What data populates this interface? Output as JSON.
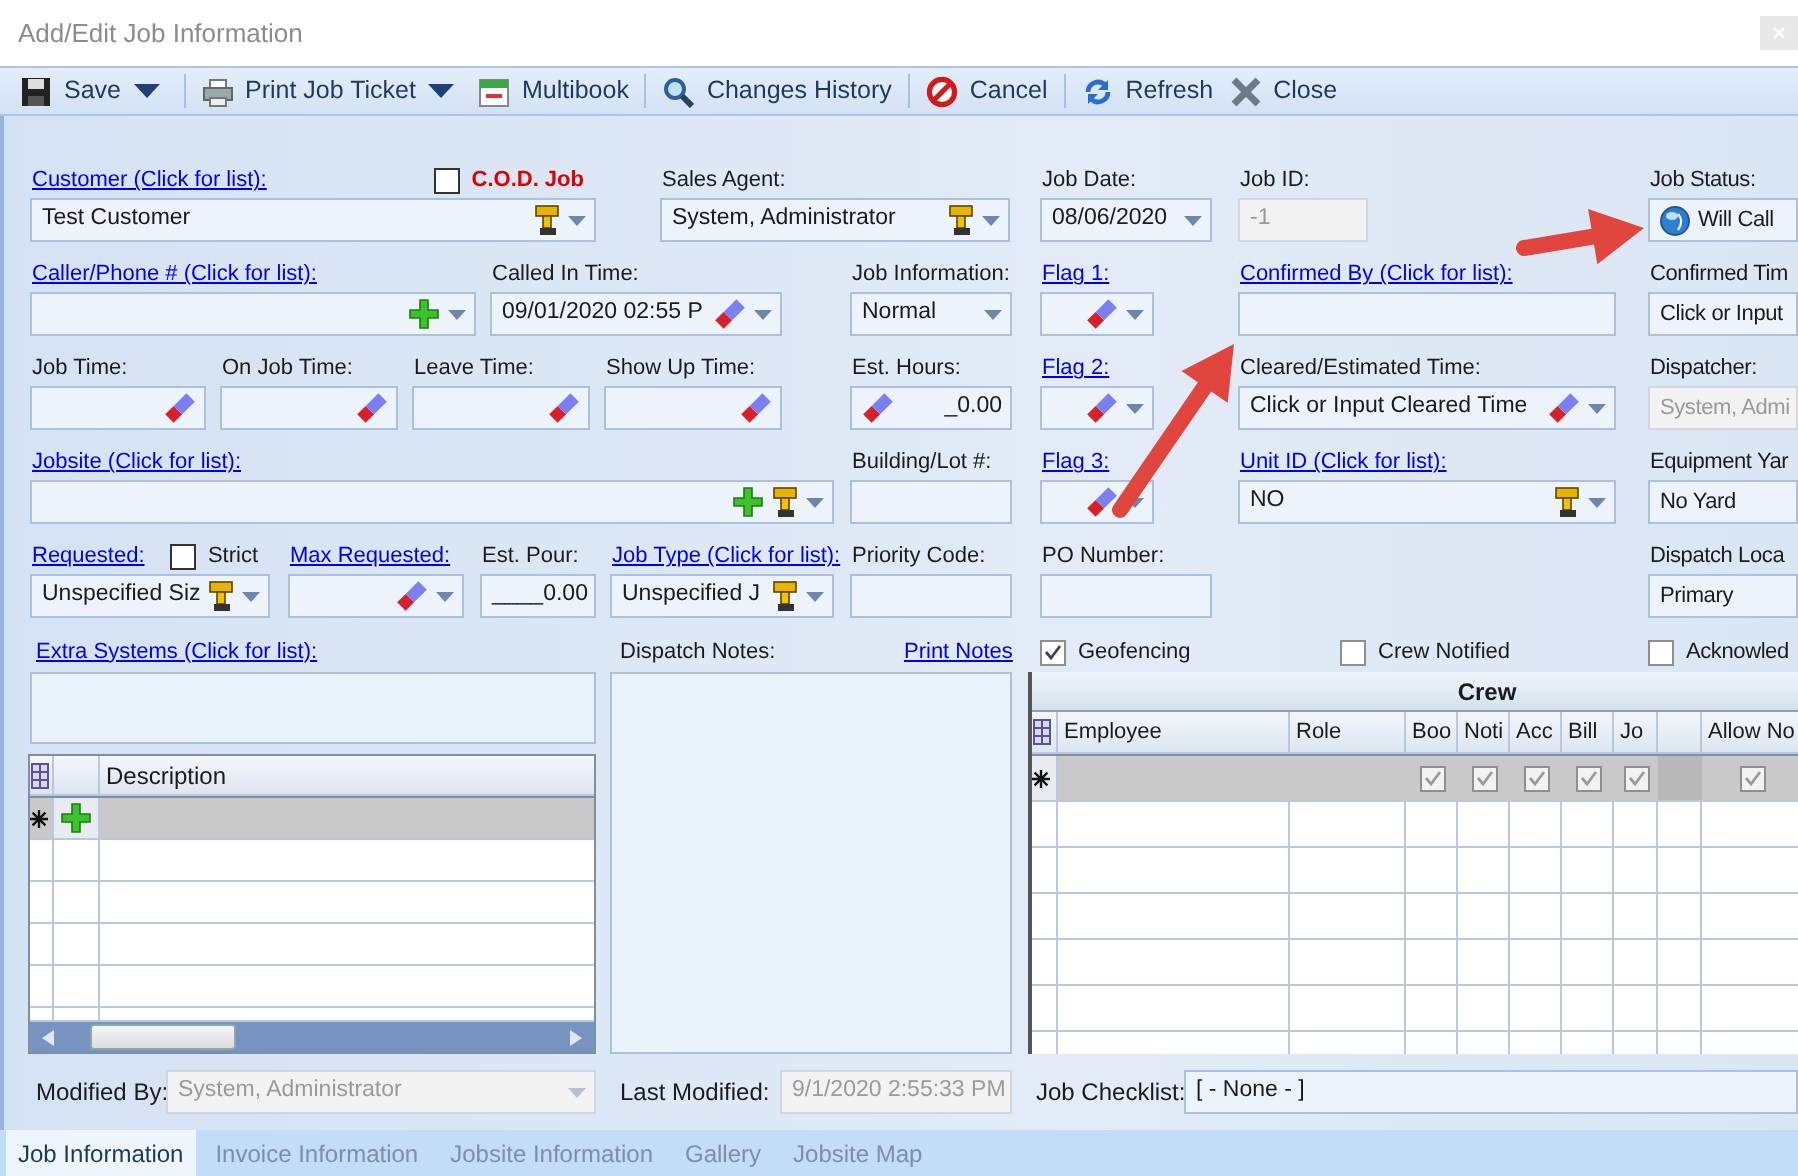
{
  "window": {
    "title": "Add/Edit Job Information"
  },
  "toolbar": [
    {
      "label": "Save",
      "menu": true
    },
    {
      "label": "Print Job Ticket",
      "menu": true
    },
    {
      "label": "Multibook",
      "menu": false
    },
    {
      "label": "Changes History",
      "menu": false
    },
    {
      "label": "Cancel",
      "menu": false
    },
    {
      "label": "Refresh",
      "menu": false
    },
    {
      "label": "Close",
      "menu": false
    }
  ],
  "rows": [
    {
      "fields": [
        {
          "kind": "lookup",
          "label": "Customer (Click for list):",
          "link": true,
          "check": {
            "label": "C.O.D. Job",
            "checked": false,
            "alert": true
          },
          "value": "Test Customer",
          "disabled": false
        },
        {
          "kind": "lookup",
          "label": "Sales Agent:",
          "link": false,
          "value": "System, Administrator",
          "disabled": false
        },
        {
          "kind": "dropdown",
          "label": "Job Date:",
          "link": false,
          "value": "08/06/2020",
          "disabled": false
        },
        {
          "kind": "text",
          "label": "Job ID:",
          "link": false,
          "value": "-1",
          "disabled": true
        },
        {
          "kind": "status",
          "label": "Job Status:",
          "link": false,
          "value": "Will Call",
          "disabled": false
        }
      ]
    },
    {
      "fields": [
        {
          "kind": "add",
          "label": "Caller/Phone # (Click for list):",
          "link": true,
          "disabled": false
        },
        {
          "kind": "time",
          "label": "Called In Time:",
          "link": false,
          "value": "09/01/2020 02:55 P",
          "disabled": false
        },
        {
          "kind": "dropdown",
          "label": "Job Information:",
          "link": false,
          "value": "Normal",
          "disabled": false
        },
        {
          "kind": "time",
          "label": "Flag 1:",
          "link": true,
          "disabled": false
        },
        {
          "kind": "text",
          "label": "Confirmed By (Click for list):",
          "link": true,
          "disabled": false
        },
        {
          "kind": "text",
          "label": "Confirmed Tim",
          "link": false,
          "value": "Click or Input",
          "disabled": false
        }
      ]
    },
    {
      "fields": [
        {
          "kind": "eraser",
          "label": "Job Time:",
          "link": false,
          "disabled": false
        },
        {
          "kind": "eraser",
          "label": "On Job Time:",
          "link": false,
          "disabled": false
        },
        {
          "kind": "eraser",
          "label": "Leave Time:",
          "link": false,
          "disabled": false
        },
        {
          "kind": "eraser",
          "label": "Show Up Time:",
          "link": false,
          "disabled": false
        },
        {
          "kind": "number-clear",
          "label": "Est. Hours:",
          "link": false,
          "value": "_0.00",
          "disabled": false
        },
        {
          "kind": "time",
          "label": "Flag 2:",
          "link": true,
          "disabled": false
        },
        {
          "kind": "time",
          "label": "Cleared/Estimated Time:",
          "link": false,
          "value": "Click or Input Cleared Time",
          "disabled": false
        },
        {
          "kind": "text",
          "label": "Dispatcher:",
          "link": false,
          "value": "System, Admi",
          "disabled": true
        }
      ]
    },
    {
      "fields": [
        {
          "kind": "add-lookup",
          "label": "Jobsite (Click for list):",
          "link": true,
          "disabled": false
        },
        {
          "kind": "text",
          "label": "Building/Lot #:",
          "link": false,
          "disabled": false
        },
        {
          "kind": "time",
          "label": "Flag 3:",
          "link": true,
          "disabled": false
        },
        {
          "kind": "lookup",
          "label": "Unit ID (Click for list):",
          "link": true,
          "value": "NO",
          "disabled": false
        },
        {
          "kind": "text",
          "label": "Equipment Yar",
          "link": false,
          "value": "No Yard",
          "disabled": false
        }
      ]
    },
    {
      "fields": [
        {
          "kind": "lookup",
          "label": "Requested:",
          "link": true,
          "check": {
            "label": "Strict",
            "checked": false,
            "alert": false
          },
          "value": "Unspecified Siz",
          "disabled": false
        },
        {
          "kind": "time",
          "label": "Max Requested:",
          "link": true,
          "disabled": false
        },
        {
          "kind": "number",
          "label": "Est. Pour:",
          "link": false,
          "value": "____0.00",
          "disabled": false
        },
        {
          "kind": "lookup",
          "label": "Job Type (Click for list):",
          "link": true,
          "value": "Unspecified J",
          "disabled": false
        },
        {
          "kind": "text",
          "label": "Priority Code:",
          "link": false,
          "disabled": false
        },
        {
          "kind": "text",
          "label": "PO Number:",
          "link": false,
          "disabled": false
        },
        {
          "kind": "text",
          "label": "Dispatch Loca",
          "link": false,
          "value": "Primary",
          "disabled": false
        }
      ]
    }
  ],
  "section_labels": [
    {
      "kind": "link",
      "text": "Extra Systems (Click for list):"
    },
    {
      "kind": "label",
      "text": "Dispatch Notes:"
    },
    {
      "kind": "link",
      "text": "Print Notes"
    },
    {
      "kind": "checkbox",
      "text": "Geofencing",
      "checked": true
    },
    {
      "kind": "checkbox",
      "text": "Crew Notified",
      "checked": false
    },
    {
      "kind": "checkbox",
      "text": "Acknowled",
      "checked": false
    }
  ],
  "extra_systems_grid": {
    "columns": [
      "Description"
    ]
  },
  "crew": {
    "title": "Crew",
    "columns": [
      {
        "kind": "text",
        "label": "Employee"
      },
      {
        "kind": "text",
        "label": "Role"
      },
      {
        "kind": "check",
        "label": "Boo",
        "default_checked": true
      },
      {
        "kind": "check",
        "label": "Noti",
        "default_checked": true
      },
      {
        "kind": "check",
        "label": "Acc",
        "default_checked": true
      },
      {
        "kind": "check",
        "label": "Bill",
        "default_checked": true
      },
      {
        "kind": "check",
        "label": "Jo",
        "default_checked": true
      },
      {
        "kind": "blank"
      },
      {
        "kind": "check",
        "label": "Allow No",
        "default_checked": true
      }
    ]
  },
  "footer": [
    {
      "label": "Modified By:",
      "kind": "dropdown",
      "value": "System, Administrator",
      "disabled": true
    },
    {
      "label": "Last Modified:",
      "kind": "text",
      "value": "9/1/2020 2:55:33 PM",
      "disabled": true
    },
    {
      "label": "Job Checklist:",
      "kind": "text",
      "value": "[ - None - ]",
      "disabled": false
    }
  ],
  "tabs": [
    {
      "label": "Job Information",
      "selected": true
    },
    {
      "label": "Invoice Information",
      "selected": false
    },
    {
      "label": "Jobsite Information",
      "selected": false
    },
    {
      "label": "Gallery",
      "selected": false
    },
    {
      "label": "Jobsite Map",
      "selected": false
    }
  ],
  "callouts": [
    {
      "kind": "arrow"
    },
    {
      "kind": "arrow"
    }
  ]
}
